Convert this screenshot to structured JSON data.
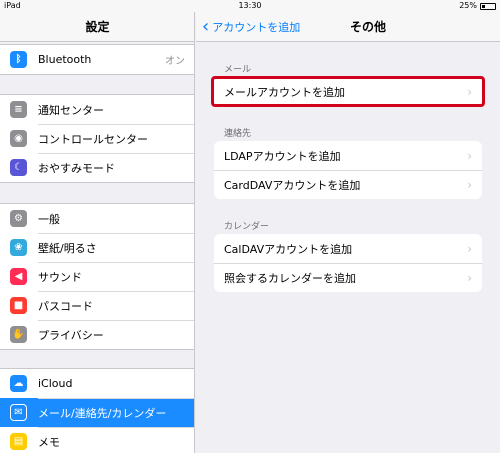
{
  "status": {
    "device": "iPad",
    "time": "13:30",
    "battery": "25%",
    "battery_level": 0.25
  },
  "sidebar": {
    "title": "設定",
    "groups": [
      [
        {
          "label": "Bluetooth",
          "value": "オン",
          "icon": "bluetooth-icon",
          "color": "#1a8cff"
        }
      ],
      [
        {
          "label": "通知センター",
          "icon": "notification-icon",
          "color": "#8e8e93"
        },
        {
          "label": "コントロールセンター",
          "icon": "control-center-icon",
          "color": "#8e8e93"
        },
        {
          "label": "おやすみモード",
          "icon": "moon-icon",
          "color": "#5856d6"
        }
      ],
      [
        {
          "label": "一般",
          "icon": "gear-icon",
          "color": "#8e8e93"
        },
        {
          "label": "壁紙/明るさ",
          "icon": "wallpaper-icon",
          "color": "#34aadc"
        },
        {
          "label": "サウンド",
          "icon": "sound-icon",
          "color": "#ff2d55"
        },
        {
          "label": "パスコード",
          "icon": "lock-icon",
          "color": "#ff3b30"
        },
        {
          "label": "プライバシー",
          "icon": "hand-icon",
          "color": "#8e8e93"
        }
      ],
      [
        {
          "label": "iCloud",
          "icon": "cloud-icon",
          "color": "#1a8cff"
        },
        {
          "label": "メール/連絡先/カレンダー",
          "icon": "mail-icon",
          "color": "#1a8cff"
        },
        {
          "label": "メモ",
          "icon": "notes-icon",
          "color": "#ffcc00"
        }
      ]
    ]
  },
  "detail": {
    "back_label": "アカウントを追加",
    "title": "その他",
    "sections": [
      {
        "header": "メール",
        "rows": [
          "メールアカウントを追加"
        ]
      },
      {
        "header": "連絡先",
        "rows": [
          "LDAPアカウントを追加",
          "CardDAVアカウントを追加"
        ]
      },
      {
        "header": "カレンダー",
        "rows": [
          "CalDAVアカウントを追加",
          "照会するカレンダーを追加"
        ]
      }
    ]
  },
  "colors": {
    "accent": "#007aff",
    "selected": "#1a8cff",
    "highlight": "#d0021b"
  }
}
